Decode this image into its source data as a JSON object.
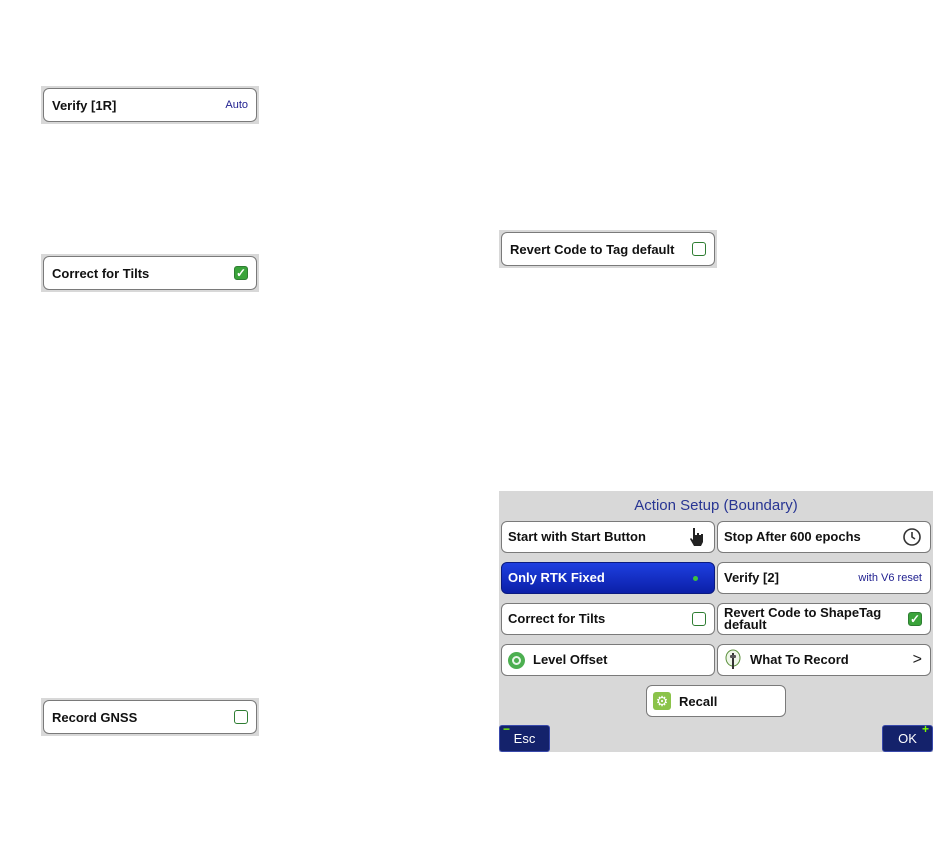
{
  "standalone": {
    "verify": {
      "label": "Verify [1R]",
      "value": "Auto"
    },
    "correct_tilts": {
      "label": "Correct for Tilts",
      "checked": true
    },
    "revert_code": {
      "label": "Revert Code to Tag default",
      "checked": false
    },
    "record_gnss": {
      "label": "Record GNSS",
      "checked": false
    }
  },
  "dialog": {
    "title": "Action Setup (Boundary)",
    "start_button": {
      "label": "Start with Start Button",
      "icon": "hand-pointer-icon"
    },
    "stop_after": {
      "label": "Stop After 600 epochs",
      "icon": "clock-icon"
    },
    "only_rtk": {
      "label": "Only RTK Fixed",
      "selected": true
    },
    "verify": {
      "label": "Verify [2]",
      "value": "with V6 reset"
    },
    "correct_tilts": {
      "label": "Correct for Tilts",
      "checked": false
    },
    "revert_code": {
      "label": "Revert Code to ShapeTag default",
      "checked": true
    },
    "level_offset": {
      "label": "Level Offset",
      "icon": "level-icon"
    },
    "what_to_record": {
      "label": "What To Record",
      "icon": "survey-pole-icon",
      "arrow": ">"
    },
    "recall": {
      "label": "Recall",
      "icon": "gear-icon"
    },
    "esc": {
      "label": "Esc",
      "mark": "−"
    },
    "ok": {
      "label": "OK",
      "mark": "+"
    }
  },
  "colors": {
    "selected_start": "#1e3fe0",
    "selected_end": "#0b1fa8",
    "title_blue": "#283593",
    "check_green": "#3aa33a",
    "softkey_bg": "#14226b"
  }
}
